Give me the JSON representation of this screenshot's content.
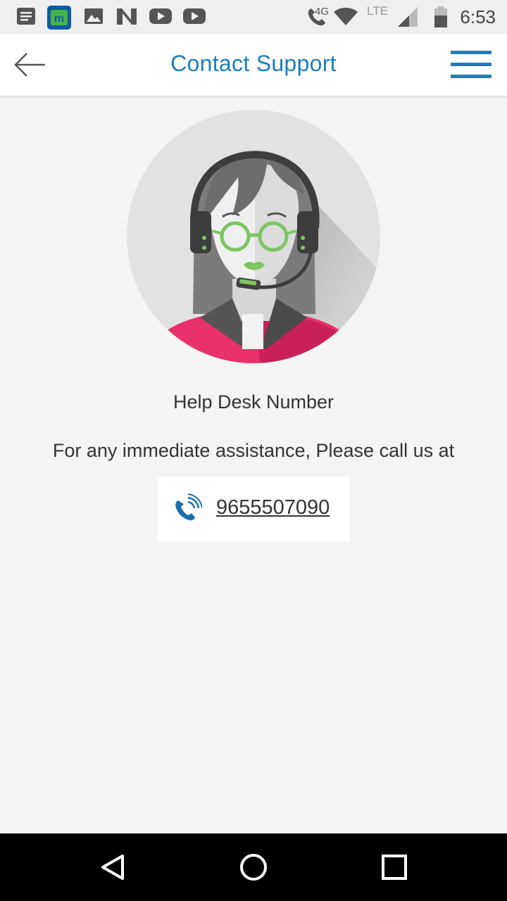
{
  "status_bar": {
    "time": "6:53",
    "network_label": "4G",
    "lte_label": "LTE",
    "icons": [
      "notes-icon",
      "m-app-icon",
      "image-icon",
      "n-app-icon",
      "youtube-icon",
      "youtube-icon",
      "call-icon",
      "wifi-icon",
      "signal-icon",
      "battery-icon"
    ]
  },
  "app_bar": {
    "title": "Contact Support"
  },
  "support": {
    "heading": "Help Desk Number",
    "description": "For any immediate assistance, Please call us at",
    "phone_number": "9655507090"
  },
  "colors": {
    "accent": "#1a7ec1",
    "background": "#f4f4f4",
    "avatar_shirt": "#e8306a",
    "avatar_glasses": "#7dc463"
  }
}
